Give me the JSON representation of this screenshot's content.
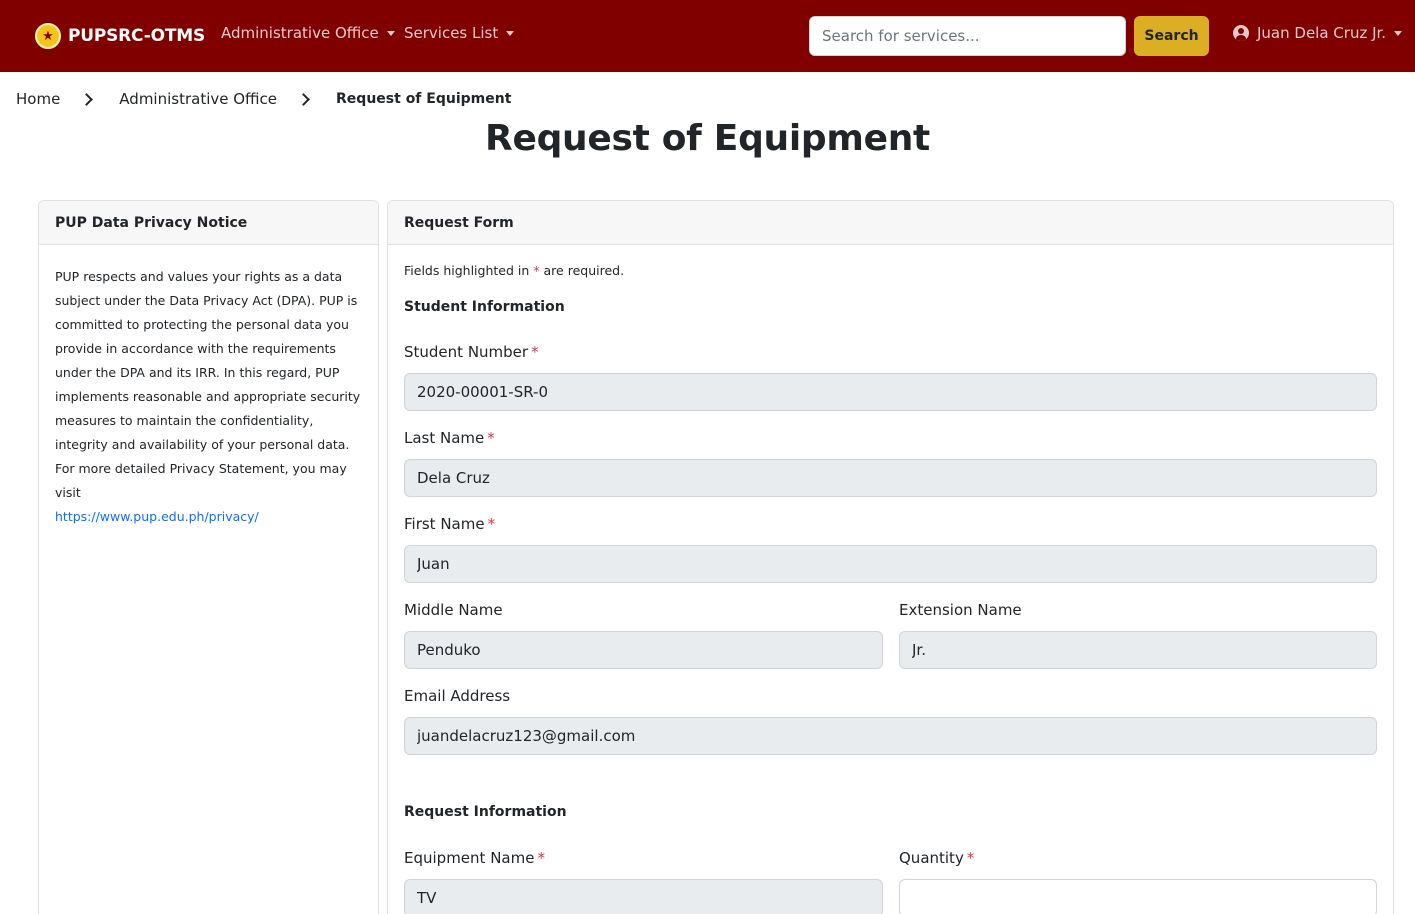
{
  "navbar": {
    "brand": "PUPSRC-OTMS",
    "brand_icon": "star-seal-icon",
    "menu_admin": "Administrative Office",
    "menu_services": "Services List",
    "search_placeholder": "Search for services...",
    "search_button": "Search",
    "user_name": "Juan Dela Cruz Jr.",
    "colors": {
      "primary": "#800000",
      "accent": "#dcae23"
    }
  },
  "breadcrumb": {
    "home": "Home",
    "office": "Administrative Office",
    "current": "Request of Equipment"
  },
  "page_title": "Request of Equipment",
  "privacy": {
    "header": "PUP Data Privacy Notice",
    "body": "PUP respects and values your rights as a data subject under the Data Privacy Act (DPA). PUP is committed to protecting the personal data you provide in accordance with the requirements under the DPA and its IRR. In this regard, PUP implements reasonable and appropriate security measures to maintain the confidentiality, integrity and availability of your personal data. For more detailed Privacy Statement, you may visit",
    "link": "https://www.pup.edu.ph/privacy/"
  },
  "form": {
    "header": "Request Form",
    "note_prefix": "Fields highlighted in",
    "note_star": "*",
    "note_suffix": "are required.",
    "student_section": "Student Information",
    "student_number_label": "Student Number",
    "student_number": "2020-00001-SR-0",
    "last_name_label": "Last Name",
    "last_name": "Dela Cruz",
    "first_name_label": "First Name",
    "first_name": "Juan",
    "middle_name_label": "Middle Name",
    "middle_name": "Penduko",
    "extension_name_label": "Extension Name",
    "extension_name": "Jr.",
    "email_label": "Email Address",
    "email": "juandelacruz123@gmail.com",
    "request_section": "Request Information",
    "equipment_label": "Equipment Name",
    "equipment": "TV",
    "quantity_label": "Quantity",
    "quantity": ""
  }
}
